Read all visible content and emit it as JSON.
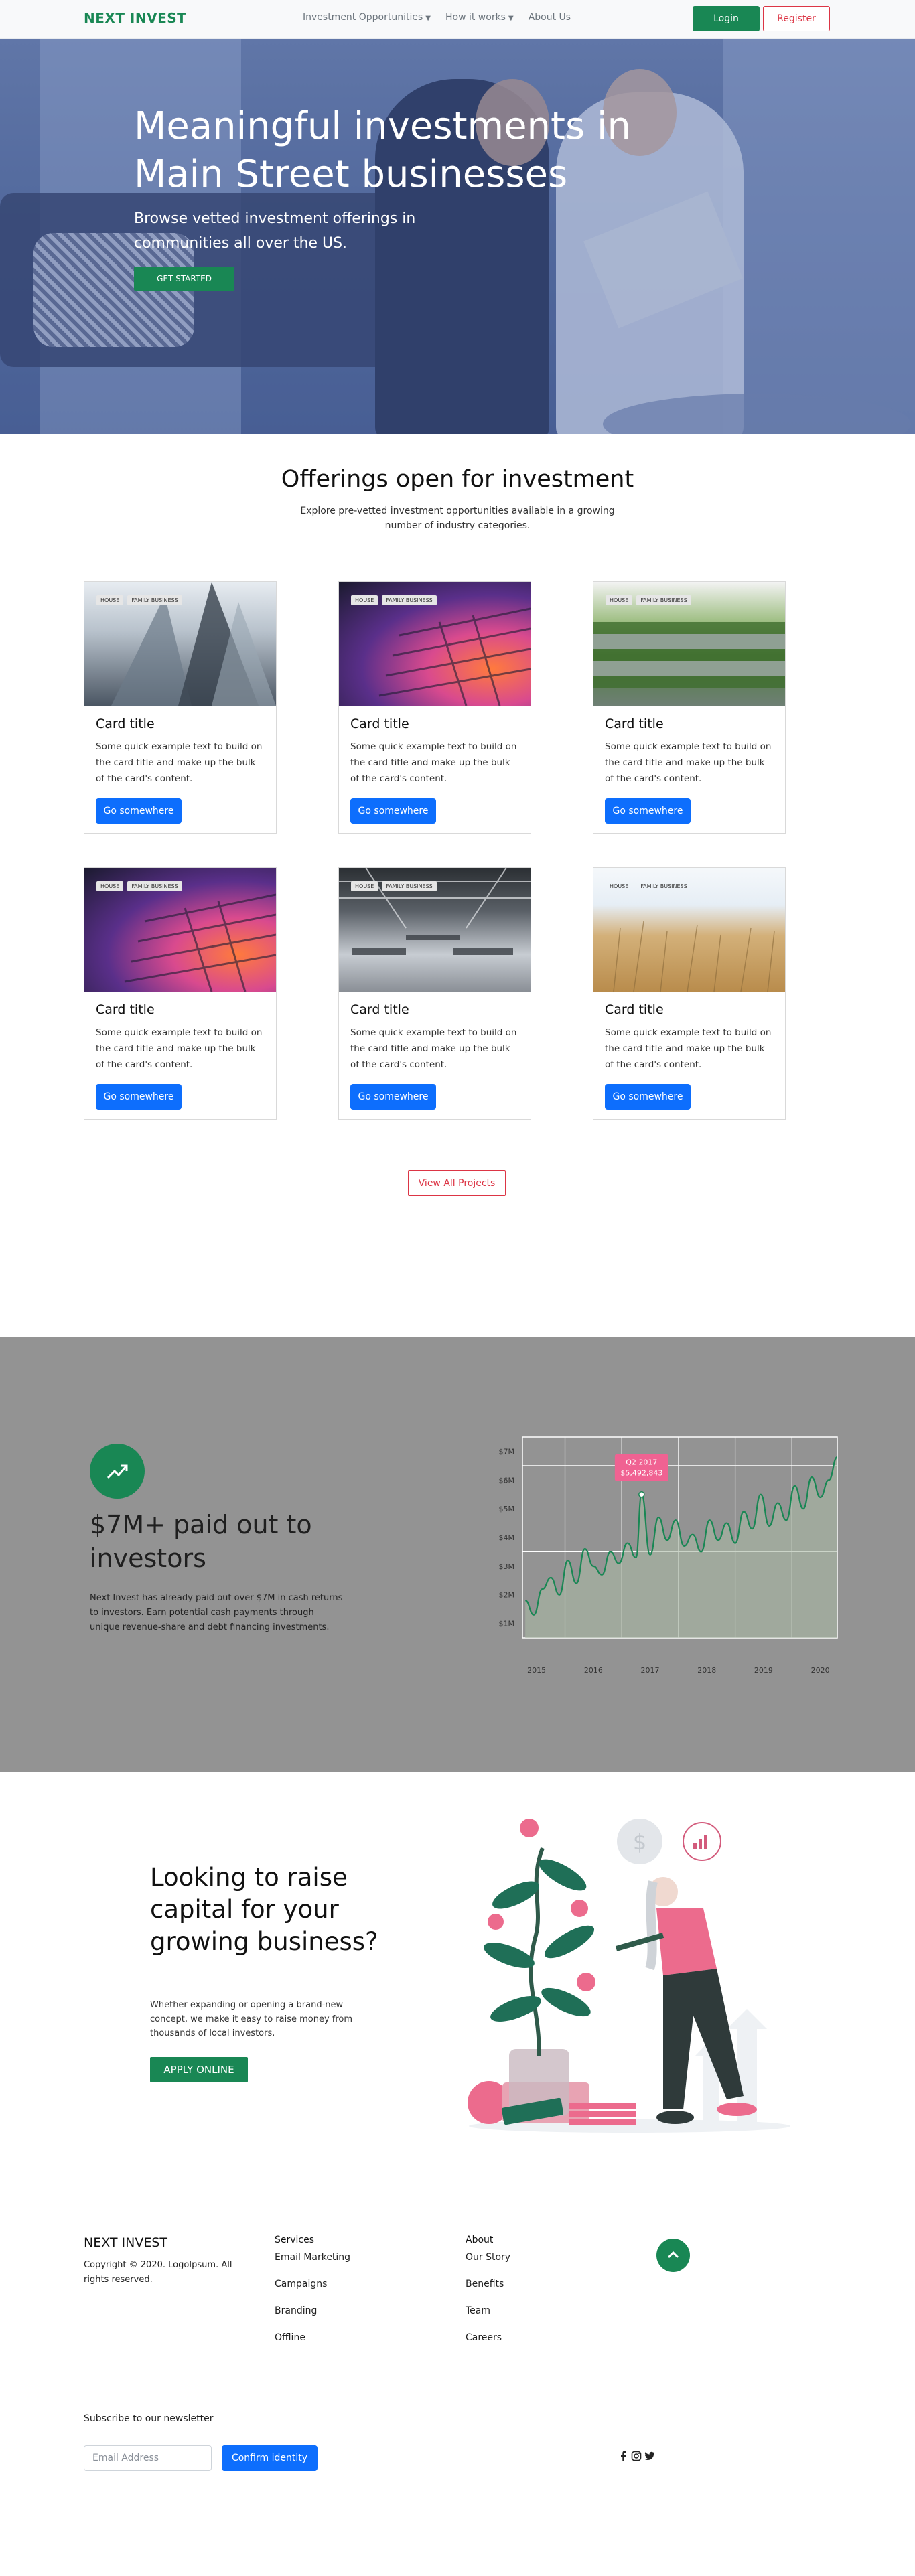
{
  "nav": {
    "brand": "NEXT INVEST",
    "links": [
      "Investment Opportunities",
      "How it works",
      "About Us"
    ],
    "login": "Login",
    "register": "Register"
  },
  "hero": {
    "title": "Meaningful investments in Main Street businesses",
    "subtitle": "Browse vetted investment offerings in communities all over the US.",
    "cta": "GET STARTED"
  },
  "offerings": {
    "title": "Offerings open for investment",
    "subtitle": "Explore pre-vetted investment opportunities available in a growing number of industry categories.",
    "cards": [
      {
        "tags": [
          "HOUSE",
          "FAMILY BUSINESS"
        ],
        "title": "Card title",
        "text": "Some quick example text to build on the card title and make up the bulk of the card's content.",
        "button": "Go somewhere"
      },
      {
        "tags": [
          "HOUSE",
          "FAMILY BUSINESS"
        ],
        "title": "Card title",
        "text": "Some quick example text to build on the card title and make up the bulk of the card's content.",
        "button": "Go somewhere"
      },
      {
        "tags": [
          "HOUSE",
          "FAMILY BUSINESS"
        ],
        "title": "Card title",
        "text": "Some quick example text to build on the card title and make up the bulk of the card's content.",
        "button": "Go somewhere"
      },
      {
        "tags": [
          "HOUSE",
          "FAMILY BUSINESS"
        ],
        "title": "Card title",
        "text": "Some quick example text to build on the card title and make up the bulk of the card's content.",
        "button": "Go somewhere"
      },
      {
        "tags": [
          "HOUSE",
          "FAMILY BUSINESS"
        ],
        "title": "Card title",
        "text": "Some quick example text to build on the card title and make up the bulk of the card's content.",
        "button": "Go somewhere"
      },
      {
        "tags": [
          "HOUSE",
          "FAMILY BUSINESS"
        ],
        "title": "Card title",
        "text": "Some quick example text to build on the card title and make up the bulk of the card's content.",
        "button": "Go somewhere"
      }
    ],
    "view_all": "View All Projects"
  },
  "stats": {
    "title": "$7M+ paid out to investors",
    "text": "Next Invest has already paid out over $7M in cash returns to investors. Earn potential cash payments through unique revenue-share and debt financing investments."
  },
  "chart_data": {
    "type": "line",
    "title": "",
    "xlabel": "",
    "ylabel": "",
    "x_ticks": [
      "2015",
      "2016",
      "2017",
      "2018",
      "2019",
      "2020"
    ],
    "y_ticks": [
      "$1M",
      "$2M",
      "$3M",
      "$4M",
      "$5M",
      "$6M",
      "$7M"
    ],
    "ylim": [
      0.5,
      7.5
    ],
    "xlim": [
      2014.75,
      2020.3
    ],
    "series": [
      {
        "x": [
          2014.8,
          2014.95,
          2015.1,
          2015.25,
          2015.4,
          2015.55,
          2015.7,
          2015.85,
          2016.0,
          2016.15,
          2016.3,
          2016.45,
          2016.6,
          2016.75,
          2016.85,
          2017.0,
          2017.15,
          2017.3,
          2017.45,
          2017.6,
          2017.75,
          2017.9,
          2018.05,
          2018.2,
          2018.35,
          2018.5,
          2018.65,
          2018.8,
          2018.95,
          2019.1,
          2019.25,
          2019.4,
          2019.55,
          2019.7,
          2019.85,
          2020.0,
          2020.15,
          2020.3
        ],
        "values": [
          1.8,
          1.3,
          2.2,
          2.6,
          2.0,
          3.2,
          2.4,
          3.6,
          3.0,
          2.7,
          3.5,
          3.1,
          3.8,
          3.3,
          5.5,
          3.4,
          4.7,
          3.9,
          4.6,
          3.7,
          4.1,
          3.5,
          4.6,
          3.9,
          4.5,
          3.8,
          4.9,
          4.3,
          5.5,
          4.4,
          5.2,
          4.6,
          5.8,
          5.0,
          6.1,
          5.4,
          6.0,
          6.8
        ]
      }
    ],
    "annotation": {
      "date": "Q2 2017",
      "value": "$5,492,843",
      "color": "#f06292"
    },
    "colors": {
      "line": "#198754",
      "fill": "#a8b8a4",
      "grid": "#ffffff"
    },
    "grid": true
  },
  "raise": {
    "title": "Looking to raise capital for your growing business?",
    "text": "Whether expanding or opening a brand-new concept, we make it easy to raise money from thousands of local investors.",
    "cta": "APPLY ONLINE"
  },
  "footer": {
    "brand": "NEXT INVEST",
    "copyright": "Copyright © 2020. LogoIpsum. All rights reserved.",
    "col1": {
      "heading": "Services",
      "links": [
        "Email Marketing",
        "Campaigns",
        "Branding",
        "Offline"
      ]
    },
    "col2": {
      "heading": "About",
      "links": [
        "Our Story",
        "Benefits",
        "Team",
        "Careers"
      ]
    },
    "newsletter_label": "Subscribe to our newsletter",
    "email_placeholder": "Email Address",
    "confirm": "Confirm identity"
  },
  "icons": {
    "nav_caret": "chevron-down-icon",
    "stats": "trending-up-icon",
    "back_to_top": "chevron-up-icon",
    "social": [
      "facebook-icon",
      "instagram-icon",
      "twitter-icon"
    ]
  },
  "theme": {
    "green": "#198754",
    "red": "#dc3545",
    "blue": "#0d6efd",
    "gray_band": "#939393"
  }
}
